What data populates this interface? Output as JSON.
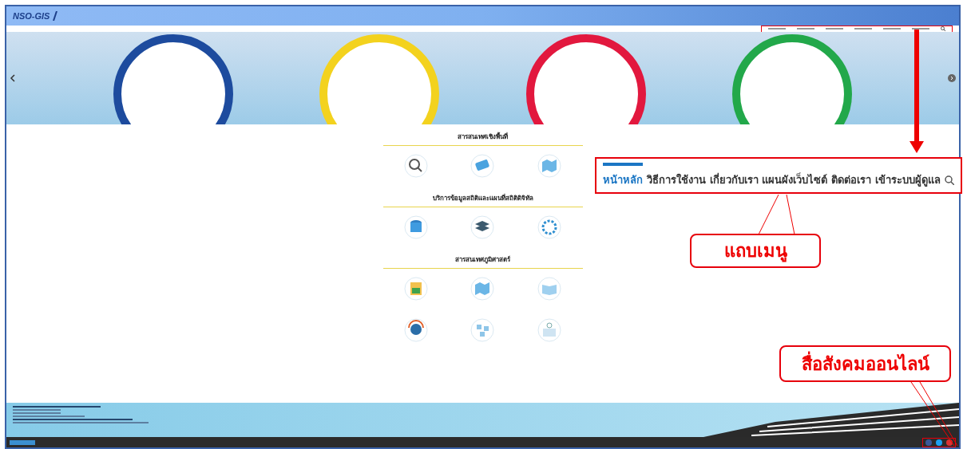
{
  "header": {
    "logo": "NSO-GIS"
  },
  "sections": [
    {
      "title": "สารสนเทศเชิงพื้นที่",
      "tiles": [
        {
          "kind": "magnifier"
        },
        {
          "kind": "phone"
        },
        {
          "kind": "map"
        }
      ]
    },
    {
      "title": "บริการข้อมูลสถิติและแผนที่สถิติดิจิทัล",
      "tiles": [
        {
          "kind": "database"
        },
        {
          "kind": "layers"
        },
        {
          "kind": "gear"
        }
      ]
    },
    {
      "title": "สารสนเทศภูมิศาสตร์",
      "tiles": [
        {
          "kind": "chart"
        },
        {
          "kind": "map"
        },
        {
          "kind": "book"
        },
        {
          "kind": "head"
        },
        {
          "kind": "network"
        },
        {
          "kind": "board"
        }
      ]
    }
  ],
  "zoomed_menu": {
    "items": [
      {
        "label": "หน้าหลัก",
        "selected": true
      },
      {
        "label": "วิธีการใช้งาน",
        "selected": false
      },
      {
        "label": "เกี่ยวกับเรา",
        "selected": false
      },
      {
        "label": "แผนผังเว็บไซต์",
        "selected": false
      },
      {
        "label": "ติดต่อเรา",
        "selected": false
      },
      {
        "label": "เข้าระบบผู้ดูแล",
        "selected": false
      }
    ]
  },
  "callouts": [
    {
      "kind": "menu",
      "text": "แถบเมนู"
    },
    {
      "kind": "social",
      "text": "สื่อสังคมออนไลน์"
    }
  ]
}
